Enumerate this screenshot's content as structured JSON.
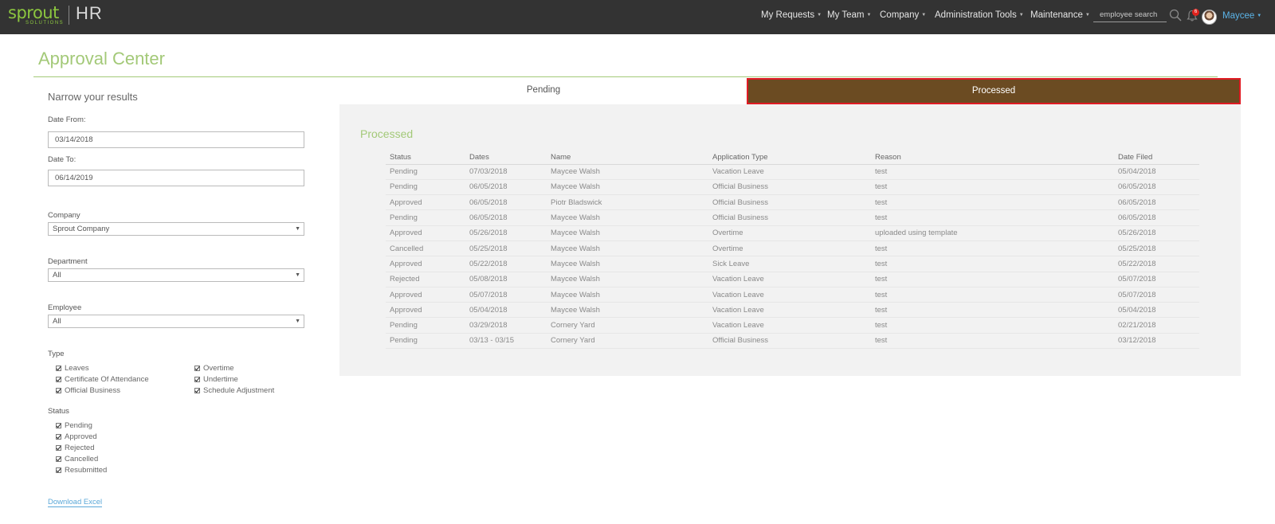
{
  "app": {
    "logo_text": "sprout",
    "logo_sub": "SOLUTIONS",
    "product": "HR"
  },
  "nav": {
    "items": [
      "My Requests",
      "My Team",
      "Company",
      "Administration Tools",
      "Maintenance"
    ],
    "search_placeholder": "employee search",
    "notification_count": "6",
    "user": "Maycee"
  },
  "page": {
    "title": "Approval Center"
  },
  "filters": {
    "heading": "Narrow your results",
    "date_from_label": "Date From:",
    "date_from": "03/14/2018",
    "date_to_label": "Date To:",
    "date_to": "06/14/2019",
    "company_label": "Company",
    "company": "Sprout Company",
    "department_label": "Department",
    "department": "All",
    "employee_label": "Employee",
    "employee": "All",
    "type_label": "Type",
    "types": [
      "Leaves",
      "Certificate Of Attendance",
      "Official Business",
      "Overtime",
      "Undertime",
      "Schedule Adjustment"
    ],
    "status_label": "Status",
    "statuses": [
      "Pending",
      "Approved",
      "Rejected",
      "Cancelled",
      "Resubmitted"
    ],
    "download": "Download Excel"
  },
  "tabs": {
    "pending": "Pending",
    "processed": "Processed"
  },
  "panel": {
    "title": "Processed",
    "columns": [
      "Status",
      "Dates",
      "Name",
      "Application Type",
      "Reason",
      "Date Filed"
    ],
    "rows": [
      [
        "Pending",
        "07/03/2018",
        "Maycee Walsh",
        "Vacation Leave",
        "test",
        "05/04/2018"
      ],
      [
        "Pending",
        "06/05/2018",
        "Maycee Walsh",
        "Official Business",
        "test",
        "06/05/2018"
      ],
      [
        "Approved",
        "06/05/2018",
        "Piotr Bladswick",
        "Official Business",
        "test",
        "06/05/2018"
      ],
      [
        "Pending",
        "06/05/2018",
        "Maycee Walsh",
        "Official Business",
        "test",
        "06/05/2018"
      ],
      [
        "Approved",
        "05/26/2018",
        "Maycee Walsh",
        "Overtime",
        "uploaded using template",
        "05/26/2018"
      ],
      [
        "Cancelled",
        "05/25/2018",
        "Maycee Walsh",
        "Overtime",
        "test",
        "05/25/2018"
      ],
      [
        "Approved",
        "05/22/2018",
        "Maycee Walsh",
        "Sick Leave",
        "test",
        "05/22/2018"
      ],
      [
        "Rejected",
        "05/08/2018",
        "Maycee Walsh",
        "Vacation Leave",
        "test",
        "05/07/2018"
      ],
      [
        "Approved",
        "05/07/2018",
        "Maycee Walsh",
        "Vacation Leave",
        "test",
        "05/07/2018"
      ],
      [
        "Approved",
        "05/04/2018",
        "Maycee Walsh",
        "Vacation Leave",
        "test",
        "05/04/2018"
      ],
      [
        "Pending",
        "03/29/2018",
        "Cornery Yard",
        "Vacation Leave",
        "test",
        "02/21/2018"
      ],
      [
        "Pending",
        "03/13 - 03/15",
        "Cornery Yard",
        "Official Business",
        "test",
        "03/12/2018"
      ]
    ]
  },
  "colors": {
    "brand_green": "#a3c978",
    "topbar": "#333333",
    "active_tab": "#6b4b22",
    "active_border": "#e01b24",
    "link": "#5ba8d8"
  }
}
